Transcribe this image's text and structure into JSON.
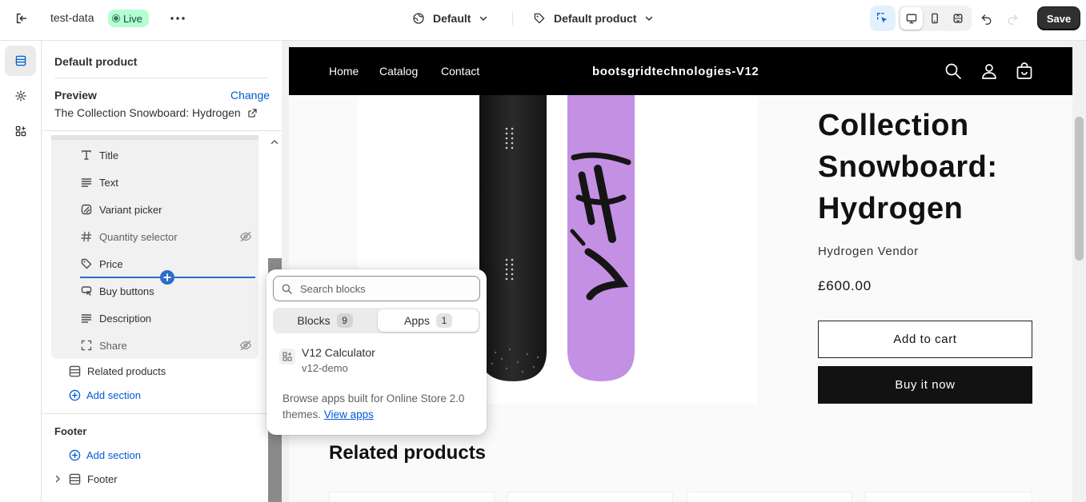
{
  "topbar": {
    "store_name": "test-data",
    "live_label": "Live",
    "theme_label": "Default",
    "template_label": "Default product",
    "save_label": "Save"
  },
  "sidebar": {
    "title": "Default product",
    "preview_label": "Preview",
    "change_label": "Change",
    "preview_product": "The Collection Snowboard: Hydrogen",
    "blocks": [
      {
        "label": "Title",
        "icon": "text-title-icon",
        "hidden": false
      },
      {
        "label": "Text",
        "icon": "text-align-icon",
        "hidden": false
      },
      {
        "label": "Variant picker",
        "icon": "variant-icon",
        "hidden": false
      },
      {
        "label": "Quantity selector",
        "icon": "hashtag-icon",
        "hidden": true
      },
      {
        "label": "Price",
        "icon": "price-tag-icon",
        "hidden": false
      },
      {
        "label": "Buy buttons",
        "icon": "cart-button-icon",
        "hidden": false
      },
      {
        "label": "Description",
        "icon": "text-align-icon",
        "hidden": false
      },
      {
        "label": "Share",
        "icon": "share-icon",
        "hidden": true
      }
    ],
    "related_products": "Related products",
    "add_section": "Add section",
    "footer_group_title": "Footer",
    "footer_add_section": "Add section",
    "footer_section": "Footer"
  },
  "popover": {
    "search_placeholder": "Search blocks",
    "tabs": [
      {
        "label": "Blocks",
        "count": "9",
        "active": false
      },
      {
        "label": "Apps",
        "count": "1",
        "active": true
      }
    ],
    "app": {
      "name": "V12 Calculator",
      "handle": "v12-demo"
    },
    "browse_text": "Browse apps built for Online Store 2.0 themes.",
    "view_apps_label": "View apps"
  },
  "store": {
    "nav": [
      "Home",
      "Catalog",
      "Contact"
    ],
    "brand": "bootsgridtechnologies-V12",
    "product_title": "Collection Snowboard: Hydrogen",
    "vendor": "Hydrogen Vendor",
    "price": "£600.00",
    "add_to_cart": "Add to cart",
    "buy_now": "Buy it now",
    "related_title": "Related products"
  },
  "colors": {
    "accent": "#005bd3",
    "insert_line": "#2c6ecb",
    "live_badge_bg": "#b4fed2",
    "save_bg": "#303030",
    "store_header_bg": "#000000",
    "board_black": "#1e1e1e",
    "board_purple": "#c490e4"
  }
}
